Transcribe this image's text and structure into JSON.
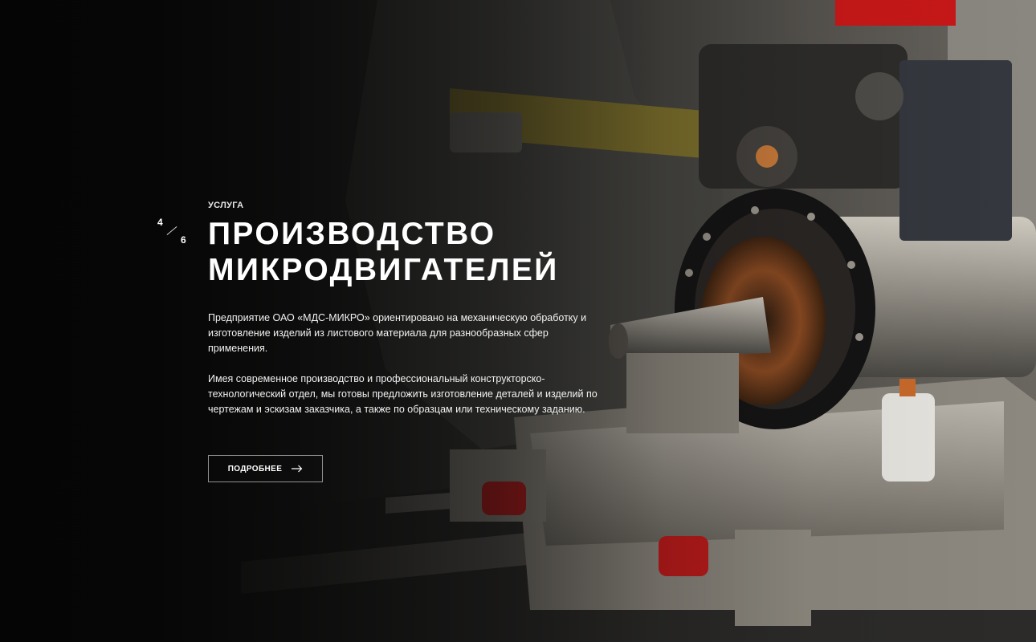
{
  "slider": {
    "current": "4",
    "total": "6"
  },
  "slide": {
    "eyebrow": "Услуга",
    "title_line1": "Производство",
    "title_line2": "микродвигателей",
    "paragraph1": "Предприятие ОАО «МДС-МИКРО» ориентировано на механическую обработку и изготовление изделий из листового материала для разнообразных сфер применения.",
    "paragraph2": "Имея современное производство и профессиональный конструкторско-технологический отдел, мы готовы предложить изготовление деталей и изделий по чертежам и эскизам заказчика, а также по образцам или техническому заданию.",
    "button_label": "Подробнее",
    "button_icon": "arrow-right-icon"
  },
  "colors": {
    "text": "#ffffff",
    "background": "#0b0b0b",
    "accent_red": "#c81818"
  }
}
